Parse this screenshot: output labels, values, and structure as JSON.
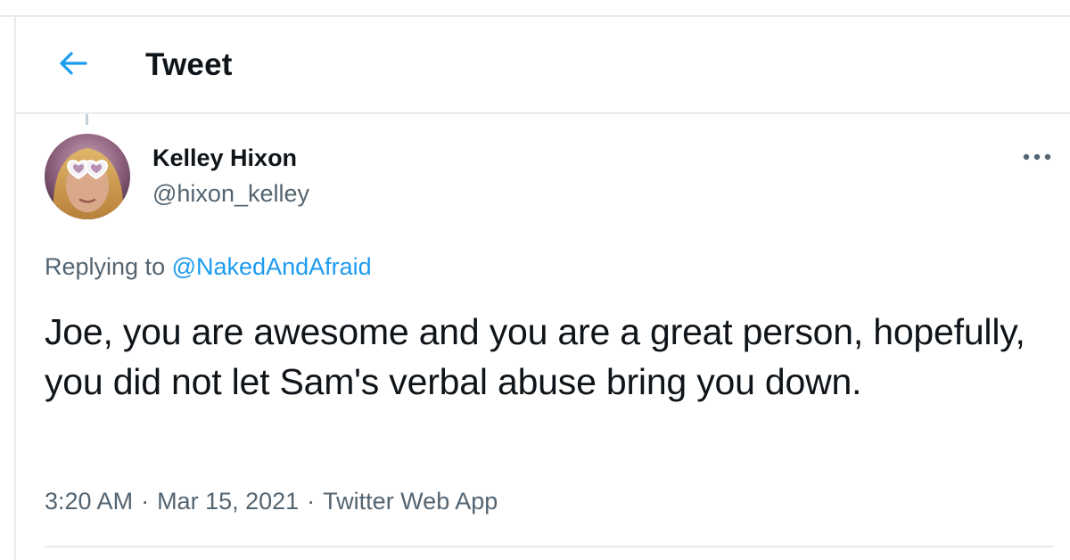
{
  "header": {
    "back_icon": "arrow-left-icon",
    "title": "Tweet"
  },
  "colors": {
    "accent": "#1d9bf0",
    "text_primary": "#0f1419",
    "text_secondary": "#536471",
    "divider": "#e6ecf0"
  },
  "tweet": {
    "author": {
      "display_name": "Kelley Hixon",
      "handle": "@hixon_kelley",
      "avatar_icon": "avatar-photo"
    },
    "more_icon": "more-options-icon",
    "replying_prefix": "Replying to",
    "replying_to": "@NakedAndAfraid",
    "text": "Joe, you are awesome and you are a great person, hopefully, you did not let Sam's verbal abuse bring you down.",
    "time": "3:20 AM",
    "date": "Mar 15, 2021",
    "source": "Twitter Web App",
    "separator": "·"
  }
}
